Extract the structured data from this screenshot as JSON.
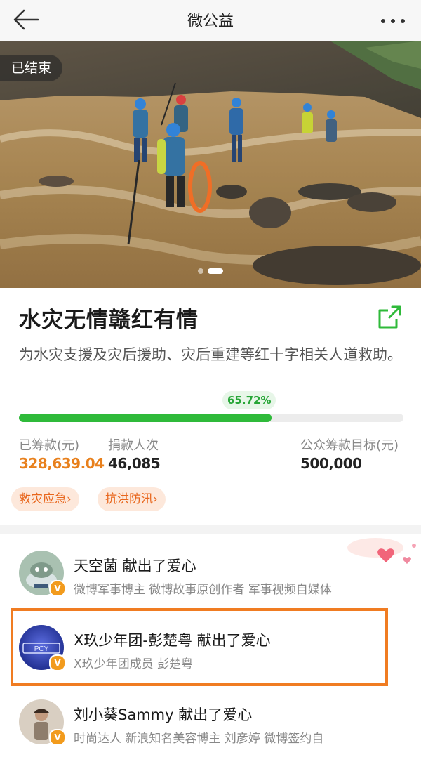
{
  "header": {
    "title": "微公益",
    "back_icon": "back-arrow-icon",
    "more_icon": "more-dots-icon"
  },
  "hero": {
    "status_badge": "已结束",
    "carousel": {
      "count": 2,
      "active_index": 1
    }
  },
  "project": {
    "title": "水灾无情赣红有情",
    "description": "为水灾支援及灾后援助、灾后重建等红十字相关人道救助。",
    "progress_percent_label": "65.72%",
    "progress_fraction": 0.6572,
    "stats": [
      {
        "label": "已筹款(元)",
        "value": "328,639.04"
      },
      {
        "label": "捐款人次",
        "value": "46,085"
      },
      {
        "label": "公众筹款目标(元)",
        "value": "500,000"
      }
    ],
    "tags": [
      "救灾应急›",
      "抗洪防汛›"
    ],
    "share_icon": "share-icon"
  },
  "donors": [
    {
      "name": "天空菌 献出了爱心",
      "subtitle": "微博军事博主 微博故事原创作者 军事视频自媒体",
      "badge": "V"
    },
    {
      "name": "X玖少年团-彭楚粤 献出了爱心",
      "subtitle": "X玖少年团成员 彭楚粤",
      "badge": "V",
      "avatar_text": "PCY"
    },
    {
      "name": "刘小葵Sammy 献出了爱心",
      "subtitle": "时尚达人 新浪知名美容博主 刘彦婷 微博签约自",
      "badge": "V"
    }
  ],
  "colors": {
    "progress": "#2fba3a",
    "amount": "#e8801c",
    "tag_bg": "#fde8db",
    "tag_text": "#e8661c",
    "highlight": "#f07c22",
    "verified_badge": "#f29b1d"
  }
}
